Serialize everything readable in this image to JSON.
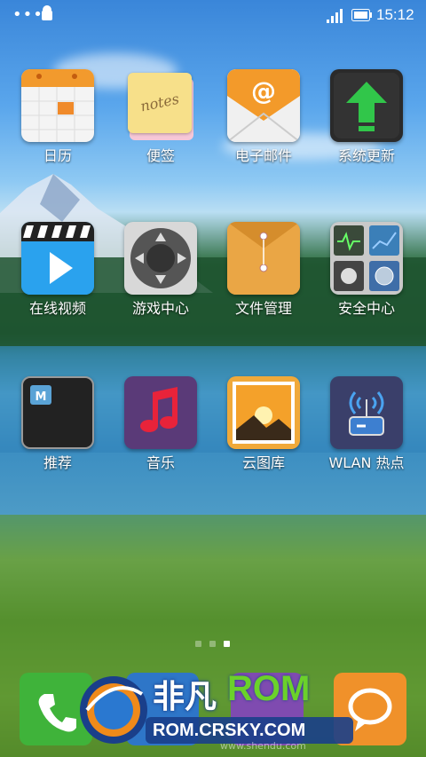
{
  "status_bar": {
    "time": "15:12"
  },
  "apps": [
    {
      "label": "日历",
      "icon": "calendar-icon"
    },
    {
      "label": "便签",
      "icon": "notes-icon",
      "icon_text": "notes"
    },
    {
      "label": "电子邮件",
      "icon": "email-icon"
    },
    {
      "label": "系统更新",
      "icon": "system-update-icon"
    },
    {
      "label": "在线视频",
      "icon": "video-icon"
    },
    {
      "label": "游戏中心",
      "icon": "game-center-icon"
    },
    {
      "label": "文件管理",
      "icon": "file-manager-icon"
    },
    {
      "label": "安全中心",
      "icon": "security-center-icon"
    },
    {
      "label": "推荐",
      "icon": "recommend-icon"
    },
    {
      "label": "音乐",
      "icon": "music-icon"
    },
    {
      "label": "云图库",
      "icon": "gallery-icon"
    },
    {
      "label": "WLAN 热点",
      "icon": "wlan-hotspot-icon"
    }
  ],
  "pager": {
    "pages": 3,
    "current": 3
  },
  "dock": [
    {
      "icon": "phone-icon"
    },
    {
      "icon": "contacts-icon"
    },
    {
      "icon": "messaging-icon"
    },
    {
      "icon": "chat-icon"
    }
  ],
  "watermark": {
    "title_a": "非凡",
    "title_b": "ROM",
    "url": "ROM.CRSKY.COM",
    "faint": "www.shendu.com"
  }
}
